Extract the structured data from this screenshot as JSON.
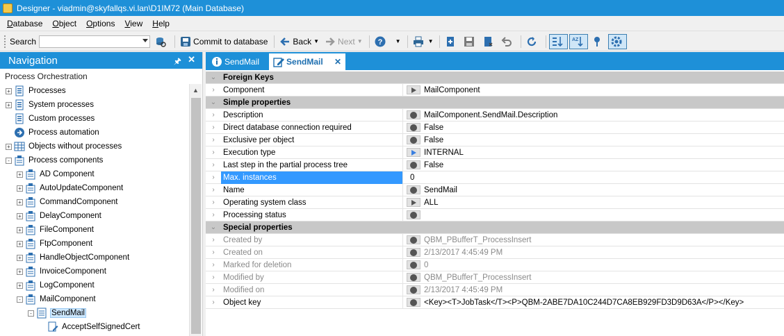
{
  "window": {
    "title": "Designer - viadmin@skyfallqs.vi.lan\\D1IM72 (Main Database)"
  },
  "menu": {
    "items": [
      "Database",
      "Object",
      "Options",
      "View",
      "Help"
    ]
  },
  "toolbar": {
    "search_label": "Search",
    "search_value": "",
    "commit_label": "Commit to database",
    "back_label": "Back",
    "next_label": "Next"
  },
  "navigation": {
    "title": "Navigation",
    "section": "Process Orchestration",
    "tree": [
      {
        "label": "Processes",
        "level": 0,
        "expander": "+",
        "icon": "process-doc-icon"
      },
      {
        "label": "System processes",
        "level": 0,
        "expander": "+",
        "icon": "process-doc-icon"
      },
      {
        "label": "Custom processes",
        "level": 0,
        "expander": "",
        "icon": "process-doc-icon"
      },
      {
        "label": "Process automation",
        "level": 0,
        "expander": "",
        "icon": "automation-icon"
      },
      {
        "label": "Objects without processes",
        "level": 0,
        "expander": "+",
        "icon": "table-icon"
      },
      {
        "label": "Process components",
        "level": 0,
        "expander": "-",
        "icon": "component-icon"
      },
      {
        "label": "AD Component",
        "level": 1,
        "expander": "+",
        "icon": "component-icon"
      },
      {
        "label": "AutoUpdateComponent",
        "level": 1,
        "expander": "+",
        "icon": "component-icon"
      },
      {
        "label": "CommandComponent",
        "level": 1,
        "expander": "+",
        "icon": "component-icon"
      },
      {
        "label": "DelayComponent",
        "level": 1,
        "expander": "+",
        "icon": "component-icon"
      },
      {
        "label": "FileComponent",
        "level": 1,
        "expander": "+",
        "icon": "component-icon"
      },
      {
        "label": "FtpComponent",
        "level": 1,
        "expander": "+",
        "icon": "component-icon"
      },
      {
        "label": "HandleObjectComponent",
        "level": 1,
        "expander": "+",
        "icon": "component-icon"
      },
      {
        "label": "InvoiceComponent",
        "level": 1,
        "expander": "+",
        "icon": "component-icon"
      },
      {
        "label": "LogComponent",
        "level": 1,
        "expander": "+",
        "icon": "component-icon"
      },
      {
        "label": "MailComponent",
        "level": 1,
        "expander": "-",
        "icon": "component-icon"
      },
      {
        "label": "SendMail",
        "level": 2,
        "expander": "-",
        "icon": "task-icon",
        "selected": true
      },
      {
        "label": "AcceptSelfSignedCert",
        "level": 3,
        "expander": "",
        "icon": "parameter-icon"
      }
    ]
  },
  "tabs": [
    {
      "label": "SendMail",
      "icon": "info-icon",
      "active": false
    },
    {
      "label": "SendMail",
      "icon": "edit-icon",
      "active": true
    }
  ],
  "properties": [
    {
      "type": "section",
      "label": "Foreign Keys"
    },
    {
      "type": "row",
      "label": "Component",
      "marker": "triangle",
      "value": "MailComponent"
    },
    {
      "type": "section",
      "label": "Simple properties"
    },
    {
      "type": "row",
      "label": "Description",
      "marker": "dot",
      "value": "MailComponent.SendMail.Description"
    },
    {
      "type": "row",
      "label": "Direct database connection required",
      "marker": "dot",
      "value": "False"
    },
    {
      "type": "row",
      "label": "Exclusive per object",
      "marker": "dot",
      "value": "False"
    },
    {
      "type": "row",
      "label": "Execution type",
      "marker": "triangle-blue",
      "value": "INTERNAL"
    },
    {
      "type": "row",
      "label": "Last step in the partial process tree",
      "marker": "dot",
      "value": "False"
    },
    {
      "type": "row",
      "label": "Max. instances",
      "marker": "none",
      "value": "0",
      "highlighted": true
    },
    {
      "type": "row",
      "label": "Name",
      "marker": "dot",
      "value": "SendMail"
    },
    {
      "type": "row",
      "label": "Operating system class",
      "marker": "triangle",
      "value": "ALL"
    },
    {
      "type": "row",
      "label": "Processing status",
      "marker": "dot",
      "value": ""
    },
    {
      "type": "section",
      "label": "Special properties"
    },
    {
      "type": "row",
      "label": "Created by",
      "marker": "dot",
      "value": "QBM_PBufferT_ProcessInsert",
      "readonly": true
    },
    {
      "type": "row",
      "label": "Created on",
      "marker": "dot",
      "value": "2/13/2017 4:45:49 PM",
      "readonly": true
    },
    {
      "type": "row",
      "label": "Marked for deletion",
      "marker": "dot",
      "value": "0",
      "readonly": true
    },
    {
      "type": "row",
      "label": "Modified by",
      "marker": "dot",
      "value": "QBM_PBufferT_ProcessInsert",
      "readonly": true
    },
    {
      "type": "row",
      "label": "Modified on",
      "marker": "dot",
      "value": "2/13/2017 4:45:49 PM",
      "readonly": true
    },
    {
      "type": "row",
      "label": "Object key",
      "marker": "dot",
      "value": "<Key><T>JobTask</T><P>QBM-2ABE7DA10C244D7CA8EB929FD3D9D63A</P></Key>"
    }
  ],
  "colors": {
    "accent": "#1e90d8",
    "highlight": "#3399ff",
    "section": "#c8c8c8"
  }
}
